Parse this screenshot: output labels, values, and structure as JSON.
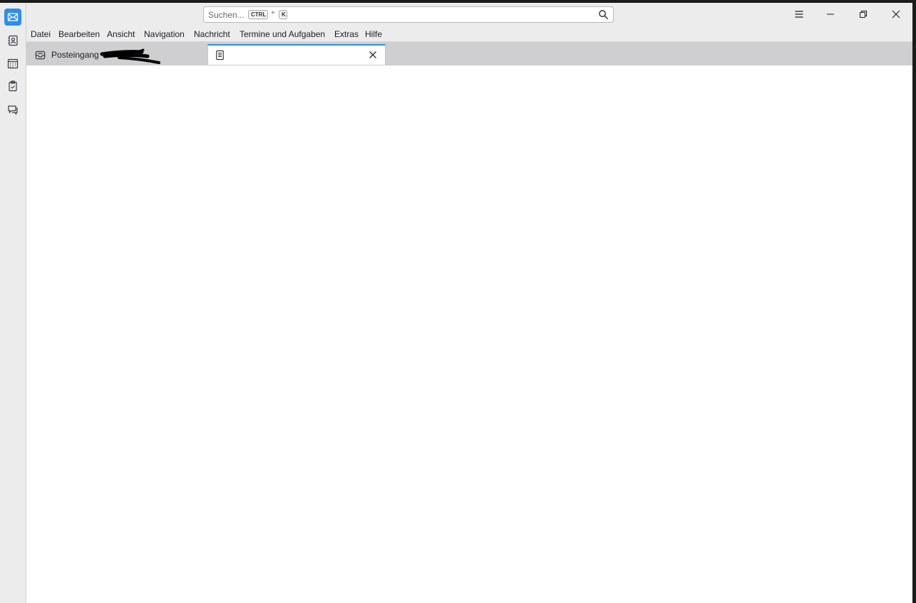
{
  "spaces": [
    {
      "name": "mail",
      "icon": "mail-icon",
      "active": true
    },
    {
      "name": "address-book",
      "icon": "address-book-icon",
      "active": false
    },
    {
      "name": "calendar",
      "icon": "calendar-icon",
      "active": false
    },
    {
      "name": "tasks",
      "icon": "tasks-icon",
      "active": false
    },
    {
      "name": "chat",
      "icon": "chat-icon",
      "active": false
    }
  ],
  "search": {
    "placeholder": "Suchen...",
    "shortcut_key1": "CTRL",
    "shortcut_plus": "+",
    "shortcut_key2": "K"
  },
  "menubar": {
    "items": [
      "Datei",
      "Bearbeiten",
      "Ansicht",
      "Navigation",
      "Nachricht",
      "Termine und Aufgaben",
      "Extras",
      "Hilfe"
    ]
  },
  "tabs": [
    {
      "label": "Posteingang",
      "icon": "inbox-icon",
      "active": false
    },
    {
      "label": "",
      "icon": "document-icon",
      "active": true
    }
  ],
  "colors": {
    "accent": "#2f8fe8",
    "chrome": "#ececec",
    "tabbar": "#cfcfd1"
  }
}
